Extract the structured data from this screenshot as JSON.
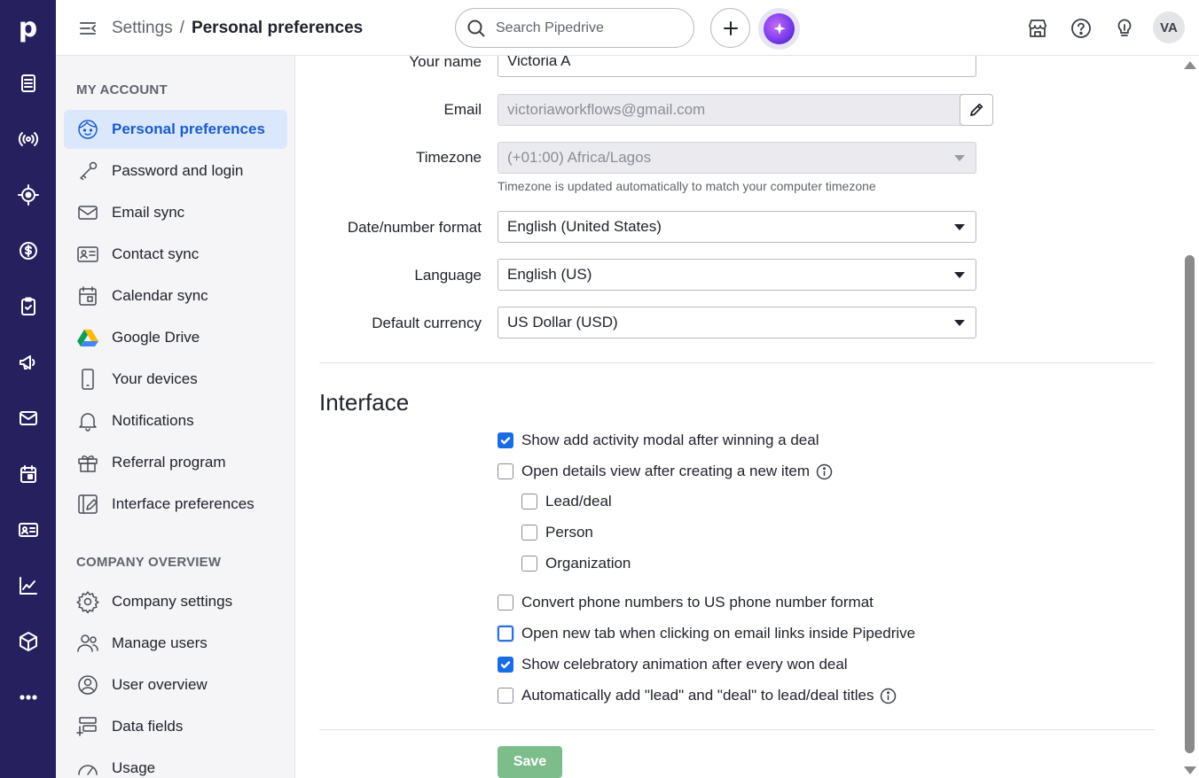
{
  "topbar": {
    "breadcrumb_parent": "Settings",
    "breadcrumb_separator": "/",
    "breadcrumb_current": "Personal preferences",
    "search_placeholder": "Search Pipedrive",
    "avatar_initials": "VA"
  },
  "rail": {
    "logo": "p",
    "icons": [
      "leads-icon",
      "broadcast-icon",
      "target-icon",
      "deals-dollar-icon",
      "tasks-clipboard-icon",
      "campaigns-megaphone-icon",
      "mail-icon",
      "calendar-icon",
      "contacts-card-icon",
      "insights-chart-icon",
      "products-box-icon",
      "more-icon"
    ]
  },
  "sidebar": {
    "my_account_heading": "MY ACCOUNT",
    "my_account_items": [
      {
        "label": "Personal preferences",
        "icon": "face-icon",
        "active": true
      },
      {
        "label": "Password and login",
        "icon": "key-icon"
      },
      {
        "label": "Email sync",
        "icon": "envelope-icon"
      },
      {
        "label": "Contact sync",
        "icon": "contact-card-icon"
      },
      {
        "label": "Calendar sync",
        "icon": "calendar-icon"
      },
      {
        "label": "Google Drive",
        "icon": "google-drive-icon"
      },
      {
        "label": "Your devices",
        "icon": "phone-icon"
      },
      {
        "label": "Notifications",
        "icon": "bell-icon"
      },
      {
        "label": "Referral program",
        "icon": "gift-icon"
      },
      {
        "label": "Interface preferences",
        "icon": "interface-edit-icon"
      }
    ],
    "company_heading": "COMPANY OVERVIEW",
    "company_items": [
      {
        "label": "Company settings",
        "icon": "gear-icon"
      },
      {
        "label": "Manage users",
        "icon": "users-icon"
      },
      {
        "label": "User overview",
        "icon": "user-circle-icon"
      },
      {
        "label": "Data fields",
        "icon": "data-fields-icon"
      },
      {
        "label": "Usage",
        "icon": "gauge-icon"
      }
    ]
  },
  "form": {
    "name_label": "Your name",
    "name_value": "Victoria A",
    "email_label": "Email",
    "email_value": "victoriaworkflows@gmail.com",
    "timezone_label": "Timezone",
    "timezone_value": "(+01:00) Africa/Lagos",
    "timezone_hint": "Timezone is updated automatically to match your computer timezone",
    "date_format_label": "Date/number format",
    "date_format_value": "English (United States)",
    "language_label": "Language",
    "language_value": "English (US)",
    "currency_label": "Default currency",
    "currency_value": "US Dollar (USD)"
  },
  "interface": {
    "title": "Interface",
    "options": [
      {
        "label": "Show add activity modal after winning a deal",
        "checked": true
      },
      {
        "label": "Open details view after creating a new item",
        "checked": false,
        "info": true
      },
      {
        "label": "Lead/deal",
        "checked": false
      },
      {
        "label": "Person",
        "checked": false
      },
      {
        "label": "Organization",
        "checked": false
      },
      {
        "label": "Convert phone numbers to US phone number format",
        "checked": false
      },
      {
        "label": "Open new tab when clicking on email links inside Pipedrive",
        "checked": false,
        "focused": true
      },
      {
        "label": "Show celebratory animation after every won deal",
        "checked": true
      },
      {
        "label": "Automatically add \"lead\" and \"deal\" to lead/deal titles",
        "checked": false,
        "info": true
      }
    ],
    "save_label": "Save"
  },
  "colors": {
    "rail_bg": "#26215e",
    "accent": "#1a6ce2",
    "active_item_bg": "#dbe8fb",
    "save_button": "#7dbd8b"
  }
}
